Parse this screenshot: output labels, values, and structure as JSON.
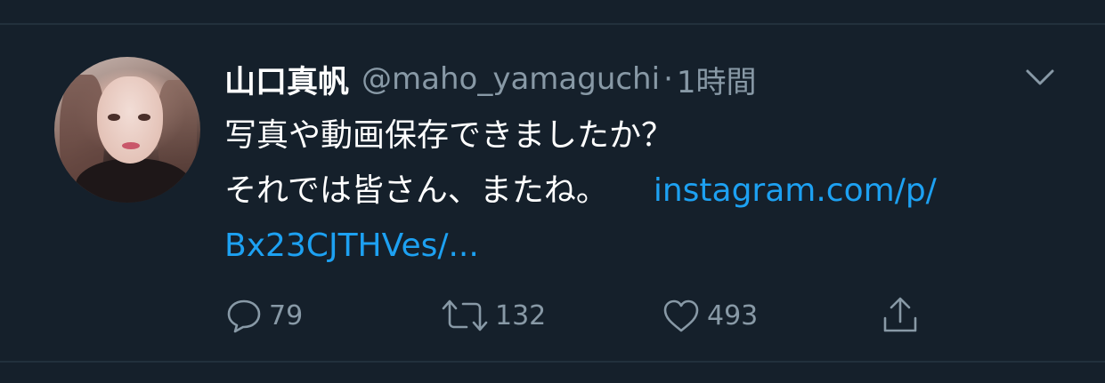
{
  "tweet": {
    "author": {
      "display_name": "山口真帆",
      "handle": "@maho_yamaguchi",
      "separator": "·",
      "time": "1時間"
    },
    "text": {
      "line1": "写真や動画保存できましたか？",
      "line2": "それでは皆さん、またね。",
      "link_part1": "instagram.com/p/",
      "link_part2": "Bx23CJTHVes/..."
    },
    "actions": {
      "reply_count": "79",
      "retweet_count": "132",
      "like_count": "493"
    },
    "icons": {
      "menu": "chevron-down-icon",
      "reply": "reply-icon",
      "retweet": "retweet-icon",
      "like": "heart-icon",
      "share": "share-icon"
    }
  },
  "colors": {
    "background": "#15202b",
    "divider": "#22303c",
    "primary_text": "#ffffff",
    "secondary_text": "#8899a6",
    "link": "#1da1f2"
  }
}
